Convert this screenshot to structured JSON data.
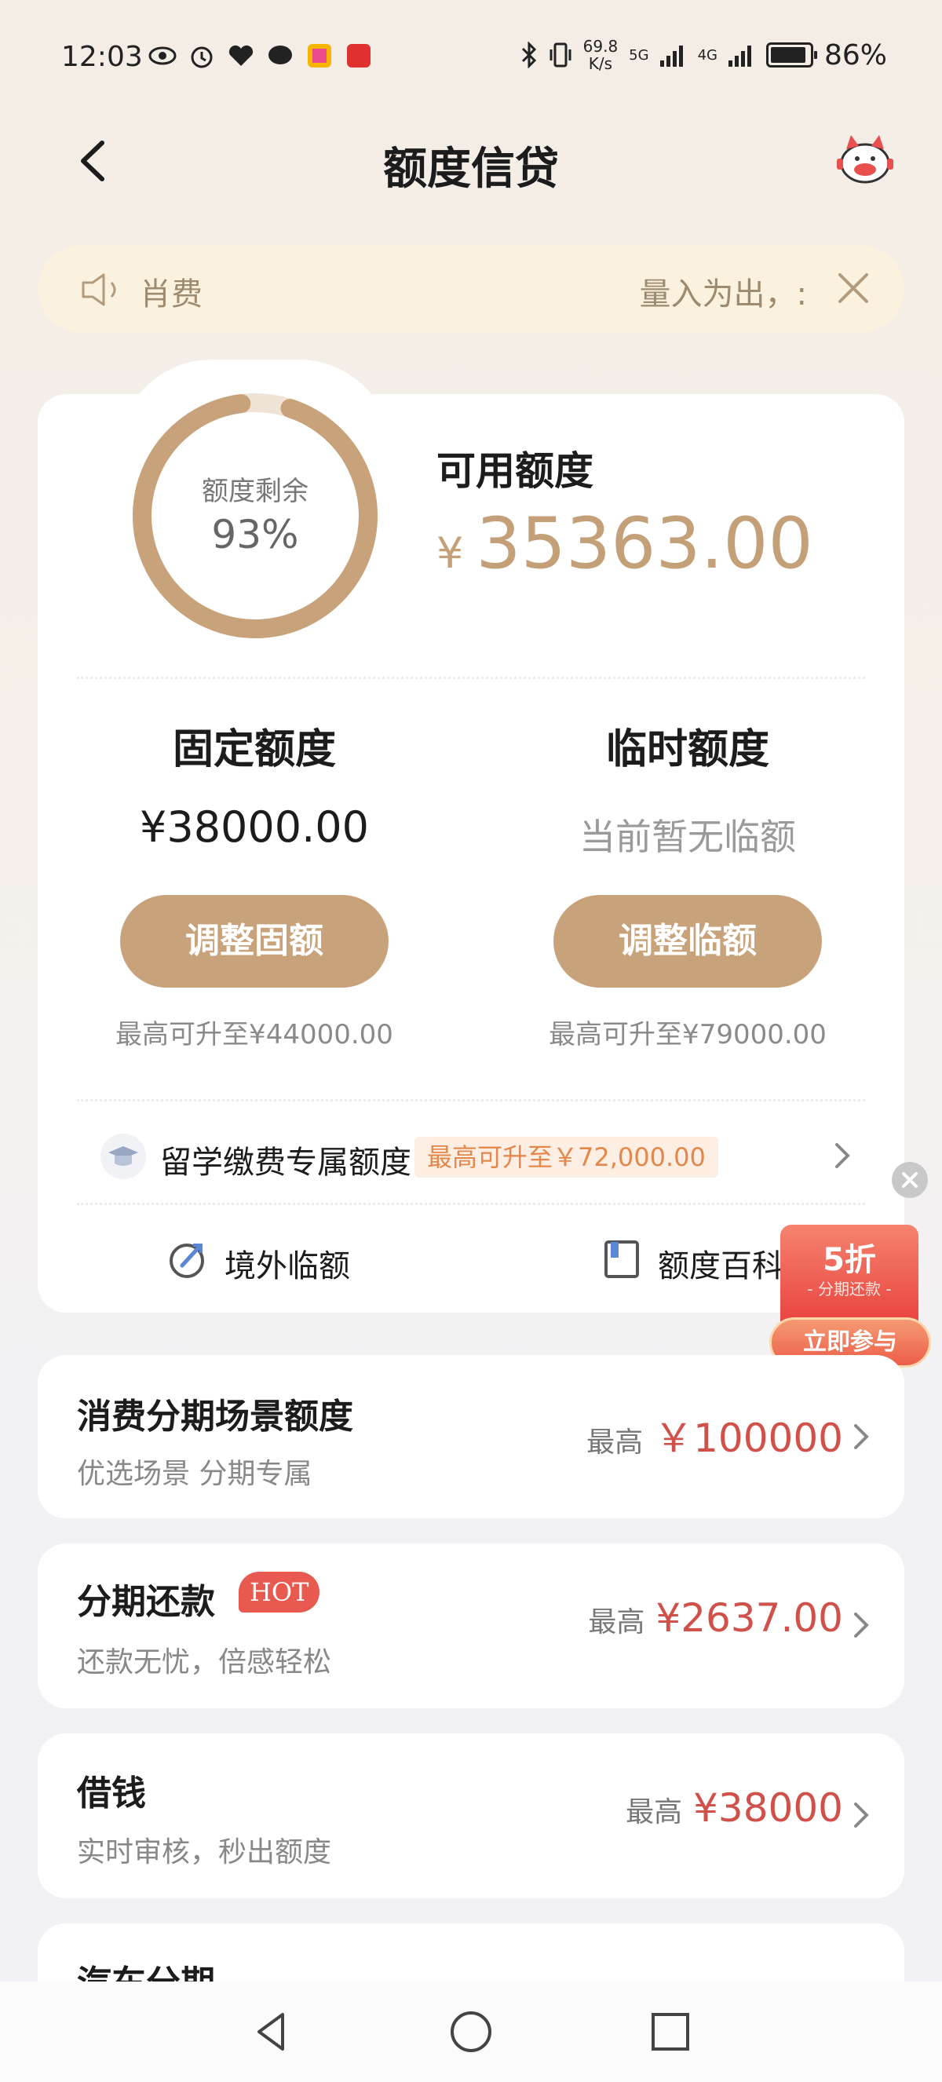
{
  "status_bar": {
    "time": "12:03",
    "net_speed": "69.8",
    "net_speed_unit": "K/s",
    "signal1": "5G",
    "signal2": "4G",
    "battery": "86%"
  },
  "header": {
    "title": "额度信贷",
    "icons": [
      "back-arrow-icon",
      "mascot-icon"
    ]
  },
  "notice": {
    "text_left": "肖费",
    "text_right": "量入为出，:"
  },
  "credit": {
    "ring_label": "额度剩余",
    "ring_value": "93%",
    "ring_fraction": 0.93,
    "available_label": "可用额度",
    "available_currency": "¥",
    "available_value": "35363.00"
  },
  "fixed": {
    "title": "固定额度",
    "value": "¥38000.00",
    "button": "调整固额",
    "sub": "最高可升至¥44000.00"
  },
  "temp": {
    "title": "临时额度",
    "value": "当前暂无临额",
    "button": "调整临额",
    "sub": "最高可升至¥79000.00"
  },
  "study": {
    "label": "留学缴费专属额度",
    "badge": "最高可升至￥72,000.00"
  },
  "links": {
    "overseas": "境外临额",
    "wiki": "额度百科"
  },
  "promo": {
    "big": "5折",
    "small": "- 分期还款 -",
    "button": "立即参与"
  },
  "products": [
    {
      "title": "消费分期场景额度",
      "sub": "优选场景 分期专属",
      "prefix": "最高",
      "amount": "￥100000"
    },
    {
      "title": "分期还款",
      "badge": "HOT",
      "sub": "还款无忧，倍感轻松",
      "prefix": "最高",
      "amount": "¥2637.00"
    },
    {
      "title": "借钱",
      "sub": "实时审核，秒出额度",
      "prefix": "最高",
      "amount": "¥38000"
    },
    {
      "title": "汽车分期"
    }
  ],
  "colors": {
    "accent": "#c8a27a",
    "amount_red": "#d0514a",
    "ring_track": "#efe3d6"
  }
}
